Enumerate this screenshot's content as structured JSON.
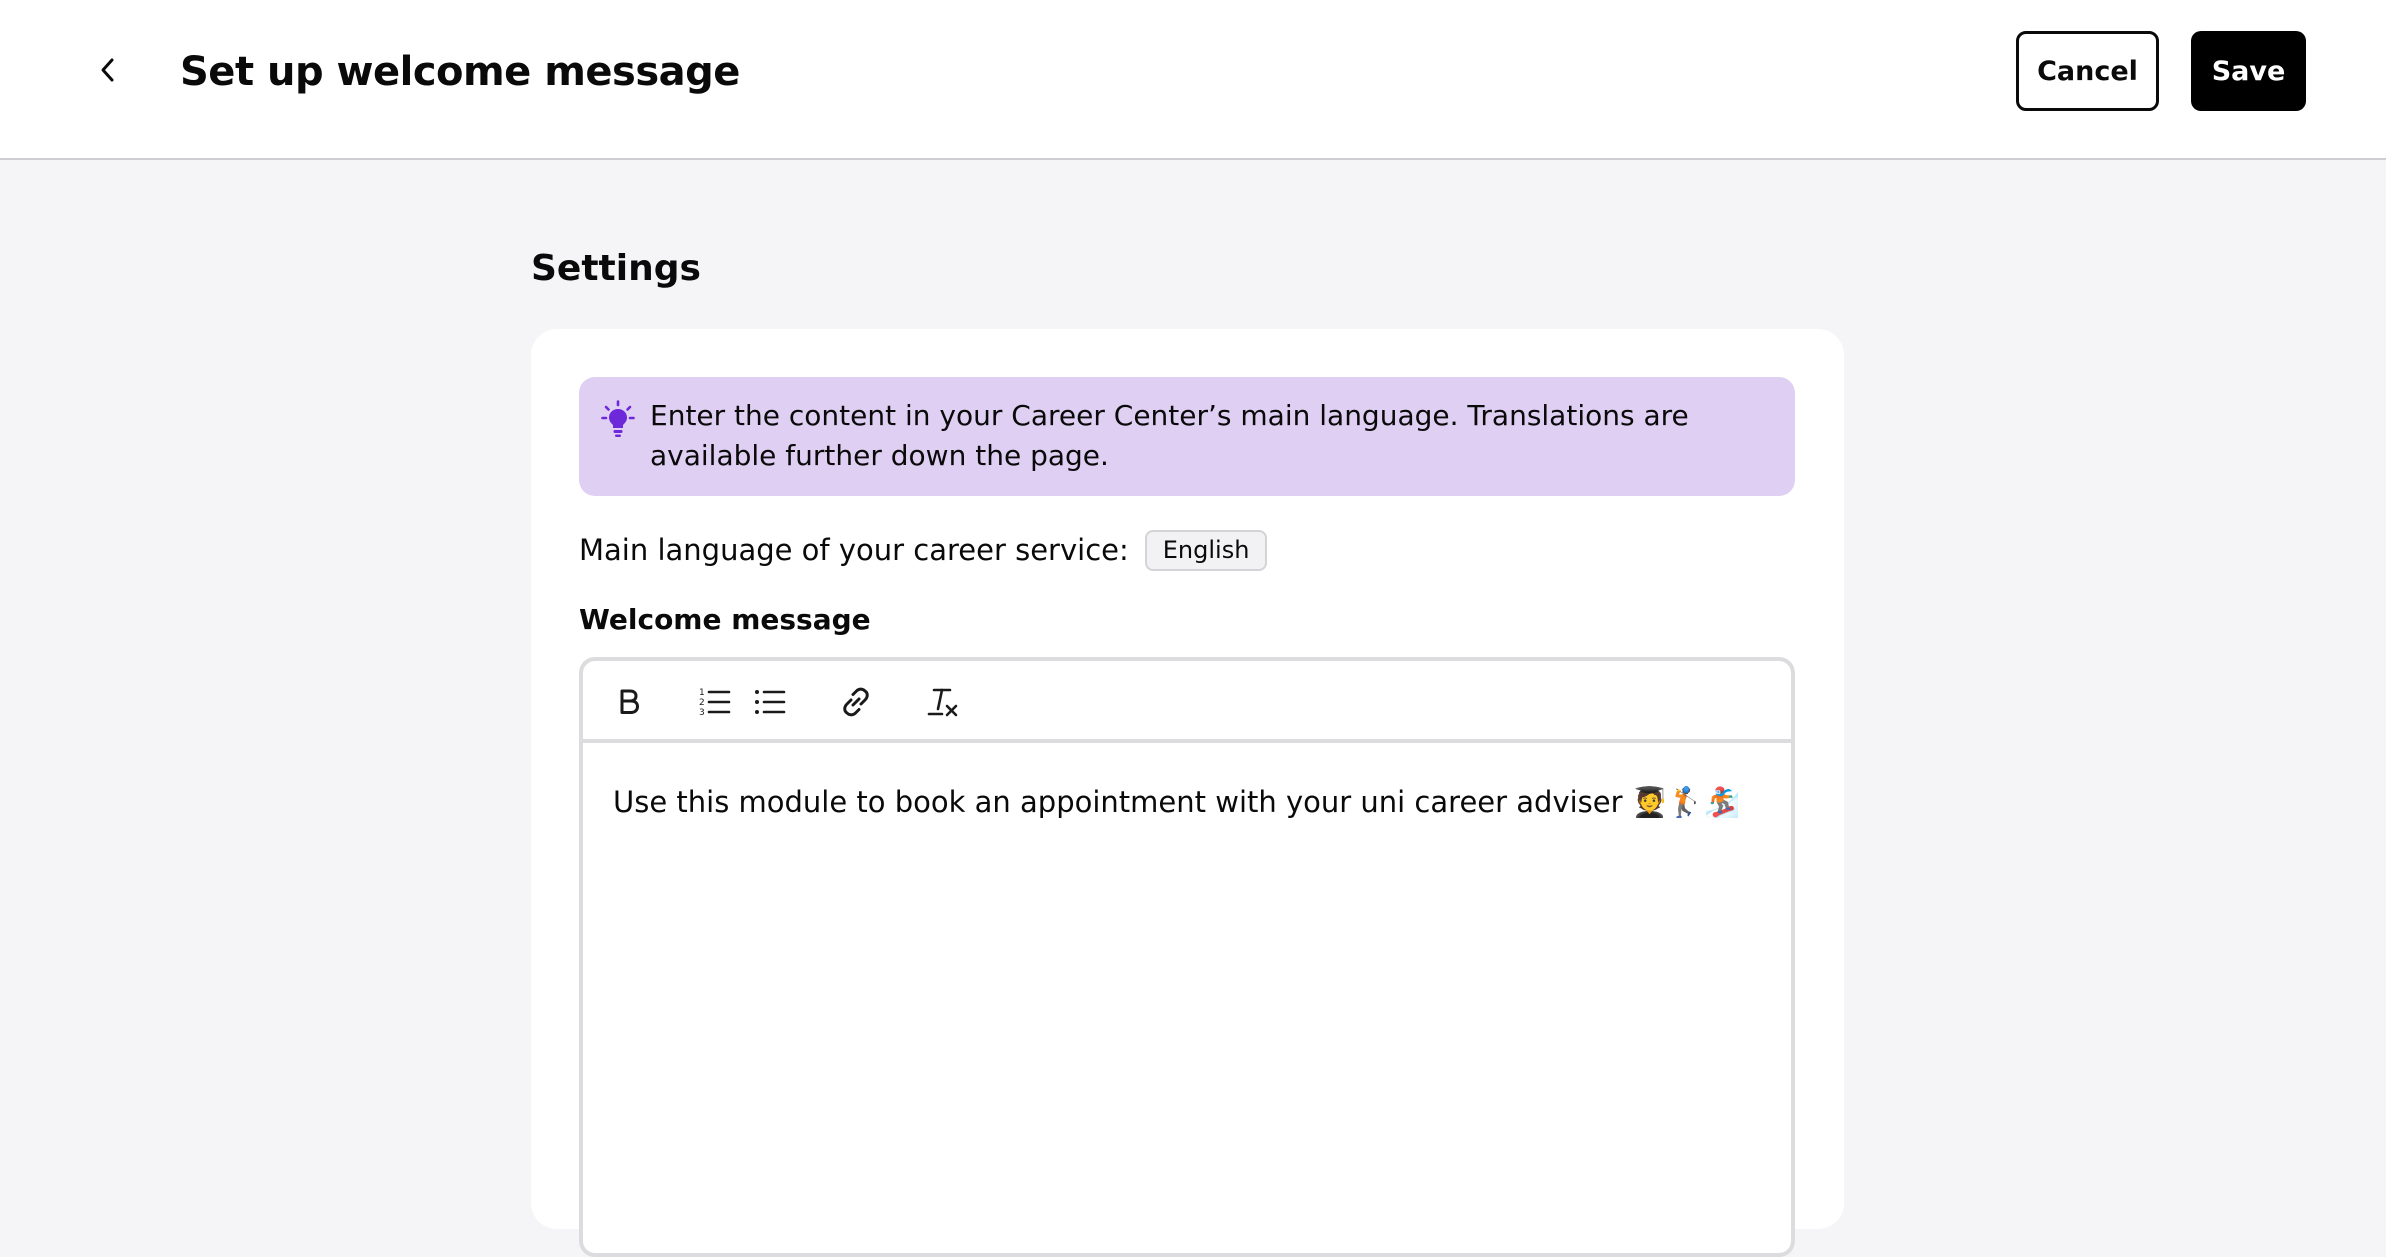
{
  "header": {
    "back_icon": "chevron-left-icon",
    "title": "Set up welcome message",
    "cancel_label": "Cancel",
    "save_label": "Save"
  },
  "main": {
    "section_title": "Settings",
    "info_banner": {
      "icon": "lightbulb-icon",
      "icon_color": "#6d28d9",
      "background_color": "#dfcff3",
      "text": "Enter the content in your Career Center’s main language. Translations are available further down the page."
    },
    "language": {
      "label": "Main language of your career service:",
      "value": "English"
    },
    "welcome_message": {
      "label": "Welcome message",
      "toolbar": [
        {
          "name": "bold",
          "icon": "bold-icon"
        },
        {
          "name": "ordered-list",
          "icon": "ordered-list-icon"
        },
        {
          "name": "bullet-list",
          "icon": "bullet-list-icon"
        },
        {
          "name": "link",
          "icon": "link-icon"
        },
        {
          "name": "clear-formatting",
          "icon": "clear-formatting-icon"
        }
      ],
      "content": "Use this module to book an appointment with your uni career adviser 🧑‍🎓🏌️🏂"
    }
  }
}
